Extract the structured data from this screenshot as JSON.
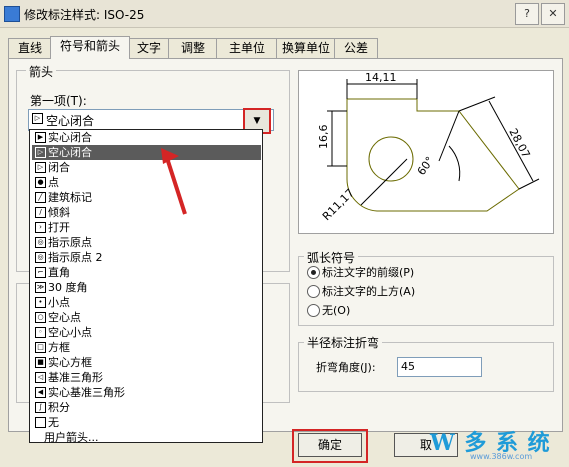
{
  "window": {
    "title": "修改标注样式: ISO-25"
  },
  "tabs": [
    "直线",
    "符号和箭头",
    "文字",
    "调整",
    "主单位",
    "换算单位",
    "公差"
  ],
  "arrowheads": {
    "group_label": "箭头",
    "first_label": "第一项(T):",
    "selected": "空心闭合",
    "options": [
      "实心闭合",
      "空心闭合",
      "闭合",
      "点",
      "建筑标记",
      "倾斜",
      "打开",
      "指示原点",
      "指示原点 2",
      "直角",
      "30 度角",
      "小点",
      "空心点",
      "空心小点",
      "方框",
      "实心方框",
      "基准三角形",
      "实心基准三角形",
      "积分",
      "无",
      "用户箭头..."
    ]
  },
  "preview": {
    "dim_top": "14,11",
    "dim_left": "16,6",
    "dim_right": "28,07",
    "dim_angle": "60°",
    "dim_radius": "R11,17"
  },
  "arc_length": {
    "group_label": "弧长符号",
    "options": [
      "标注文字的前缀(P)",
      "标注文字的上方(A)",
      "无(O)"
    ],
    "selected_index": 0
  },
  "radius_jog": {
    "group_label": "半径标注折弯",
    "angle_label": "折弯角度(J):",
    "angle_value": "45"
  },
  "buttons": {
    "ok": "确定",
    "cancel_partial": "取"
  },
  "watermark": {
    "text": "W 多 系 统",
    "sub": "www.386w.com"
  },
  "colors": {
    "highlight": "#d42525",
    "selection": "#5b5b5b",
    "preview_line": "#6b6b00"
  }
}
